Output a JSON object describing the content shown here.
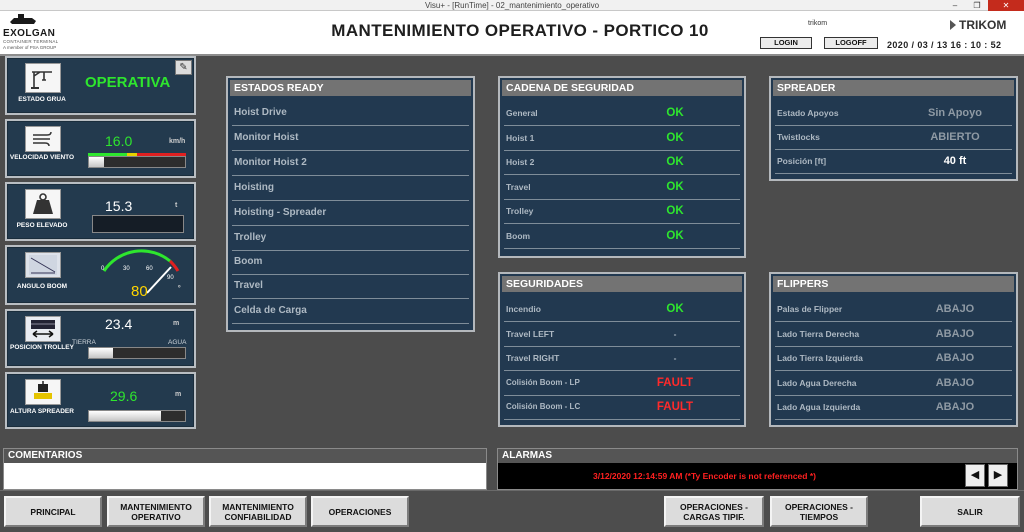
{
  "window": {
    "title": "Visu+ - [RunTime] - 02_mantenimiento_operativo",
    "minimize": "–",
    "maximize": "❐",
    "close": "✕"
  },
  "header": {
    "logo": {
      "name": "EXOLGAN",
      "sub": "CONTAINER TERMINAL",
      "group": "A member of PSA GROUP"
    },
    "title": "MANTENIMIENTO OPERATIVO - PORTICO 10",
    "user": "trikom",
    "login": "LOGIN",
    "logoff": "LOGOFF",
    "datetime": "2020 / 03 / 13   16 : 10 : 52",
    "brand": "TRIKOM"
  },
  "widgets": {
    "estado_grua": {
      "label": "ESTADO GRUA",
      "value": "OPERATIVA",
      "icon": "crane-icon",
      "edit_icon": "edit-icon"
    },
    "velocidad_viento": {
      "label": "VELOCIDAD VIENTO",
      "value": "16.0",
      "unit": "km/h",
      "icon": "wind-icon"
    },
    "peso_elevado": {
      "label": "PESO ELEVADO",
      "value": "15.3",
      "unit": "t",
      "icon": "weight-icon",
      "level": 0.0
    },
    "angulo_boom": {
      "label": "ANGULO BOOM",
      "value": "80",
      "unit": "º",
      "icon": "boom-icon",
      "ticks": [
        "0",
        "30",
        "60",
        "90"
      ],
      "gauge_value": 80
    },
    "posicion_trolley": {
      "label": "POSICION TROLLEY",
      "value": "23.4",
      "unit": "m",
      "left": "TIERRA",
      "right": "AGUA",
      "icon": "trolley-icon",
      "level": 0.25
    },
    "altura_spreader": {
      "label": "ALTURA SPREADER",
      "value": "29.6",
      "unit": "m",
      "icon": "spreader-icon",
      "level": 0.75
    }
  },
  "estados_ready": {
    "title": "ESTADOS READY",
    "items": [
      "Hoist Drive",
      "Monitor Hoist",
      "Monitor Hoist 2",
      "Hoisting",
      "Hoisting - Spreader",
      "Trolley",
      "Boom",
      "Travel",
      "Celda de Carga"
    ]
  },
  "cadena_seguridad": {
    "title": "CADENA DE SEGURIDAD",
    "items": [
      {
        "label": "General",
        "value": "OK"
      },
      {
        "label": "Hoist 1",
        "value": "OK"
      },
      {
        "label": "Hoist 2",
        "value": "OK"
      },
      {
        "label": "Travel",
        "value": "OK"
      },
      {
        "label": "Trolley",
        "value": "OK"
      },
      {
        "label": "Boom",
        "value": "OK"
      }
    ]
  },
  "spreader": {
    "title": "SPREADER",
    "items": [
      {
        "label": "Estado Apoyos",
        "value": "Sin Apoyo"
      },
      {
        "label": "Twistlocks",
        "value": "ABIERTO"
      },
      {
        "label": "Posición [ft]",
        "value": "40 ft"
      }
    ]
  },
  "seguridades": {
    "title": "SEGURIDADES",
    "items": [
      {
        "label": "Incendio",
        "value": "OK"
      },
      {
        "label": "Travel LEFT",
        "value": "-"
      },
      {
        "label": "Travel RIGHT",
        "value": "-"
      },
      {
        "label": "Colisión Boom - LP",
        "value": "FAULT"
      },
      {
        "label": "Colisión Boom - LC",
        "value": "FAULT"
      }
    ]
  },
  "flippers": {
    "title": "FLIPPERS",
    "items": [
      {
        "label": "Palas de Flipper",
        "value": "ABAJO"
      },
      {
        "label": "Lado Tierra Derecha",
        "value": "ABAJO"
      },
      {
        "label": "Lado Tierra Izquierda",
        "value": "ABAJO"
      },
      {
        "label": "Lado Agua Derecha",
        "value": "ABAJO"
      },
      {
        "label": "Lado Agua Izquierda",
        "value": "ABAJO"
      }
    ]
  },
  "comentarios": {
    "title": "COMENTARIOS"
  },
  "alarmas": {
    "title": "ALARMAS",
    "message": "3/12/2020 12:14:59 AM   (*Ty Encoder is not referenced *)",
    "prev": "◀",
    "next": "▶"
  },
  "nav": {
    "principal": "PRINCIPAL",
    "mant_operativo": "MANTENIMIENTO OPERATIVO",
    "mant_confiabilidad": "MANTENIMIENTO CONFIABILIDAD",
    "operaciones": "OPERACIONES",
    "op_cargas": "OPERACIONES - CARGAS TIPIF.",
    "op_tiempos": "OPERACIONES - TIEMPOS",
    "salir": "SALIR"
  },
  "colors": {
    "panel_bg": "#223950",
    "ok": "#2ee62e",
    "fault": "#ff2a2a",
    "operativa": "#2ee62e"
  }
}
